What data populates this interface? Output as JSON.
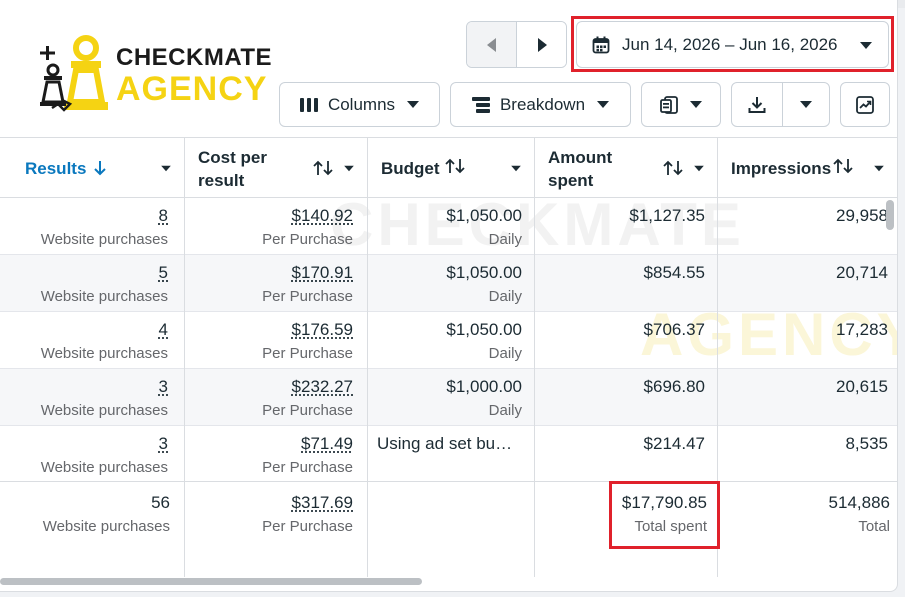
{
  "logo": {
    "line1": "CHECKMATE",
    "line2": "AGENCY"
  },
  "watermark": {
    "line1": "CHECKMATE",
    "line2": "AGENCY"
  },
  "toolbar": {
    "date_range": "Jun 14, 2026 – Jun 16, 2026",
    "columns_label": "Columns",
    "breakdown_label": "Breakdown"
  },
  "table": {
    "headers": {
      "results": "Results",
      "cost_per_result_1": "Cost per",
      "cost_per_result_2": "result",
      "budget": "Budget",
      "amount_spent_1": "Amount",
      "amount_spent_2": "spent",
      "impressions": "Impressions"
    },
    "rows": [
      {
        "results": "8",
        "results_sub": "Website purchases",
        "cpr": "$140.92",
        "cpr_sub": "Per Purchase",
        "budget": "$1,050.00",
        "budget_sub": "Daily",
        "spent": "$1,127.35",
        "impressions": "29,958"
      },
      {
        "results": "5",
        "results_sub": "Website purchases",
        "cpr": "$170.91",
        "cpr_sub": "Per Purchase",
        "budget": "$1,050.00",
        "budget_sub": "Daily",
        "spent": "$854.55",
        "impressions": "20,714"
      },
      {
        "results": "4",
        "results_sub": "Website purchases",
        "cpr": "$176.59",
        "cpr_sub": "Per Purchase",
        "budget": "$1,050.00",
        "budget_sub": "Daily",
        "spent": "$706.37",
        "impressions": "17,283"
      },
      {
        "results": "3",
        "results_sub": "Website purchases",
        "cpr": "$232.27",
        "cpr_sub": "Per Purchase",
        "budget": "$1,000.00",
        "budget_sub": "Daily",
        "spent": "$696.80",
        "impressions": "20,615"
      },
      {
        "results": "3",
        "results_sub": "Website purchases",
        "cpr": "$71.49",
        "cpr_sub": "Per Purchase",
        "budget": "Using ad set bu…",
        "budget_sub": "",
        "spent": "$214.47",
        "impressions": "8,535"
      }
    ],
    "totals": {
      "results": "56",
      "results_sub": "Website purchases",
      "cpr": "$317.69",
      "cpr_sub": "Per Purchase",
      "spent": "$17,790.85",
      "spent_sub": "Total spent",
      "impressions": "514,886",
      "impressions_sub": "Total"
    }
  },
  "colors": {
    "accent": "#0a78be",
    "highlight": "#e0212b",
    "brand_yellow": "#f5d313"
  }
}
